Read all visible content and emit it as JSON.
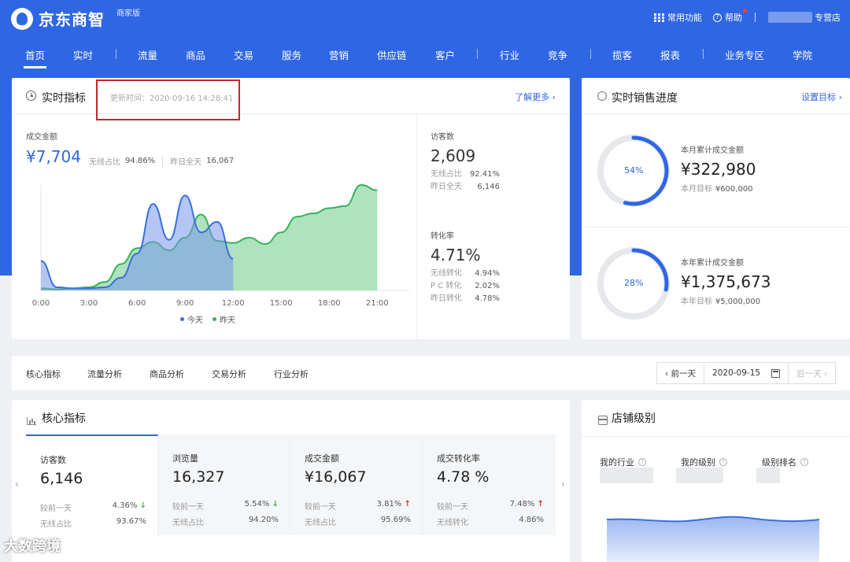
{
  "header": {
    "brand": "京东商智",
    "edition": "商家版",
    "common_functions": "常用功能",
    "help": "帮助",
    "shop_suffix": "专营店"
  },
  "nav": [
    {
      "label": "首页",
      "active": true
    },
    {
      "label": "实时"
    },
    {
      "label": "流量"
    },
    {
      "label": "商品"
    },
    {
      "label": "交易"
    },
    {
      "label": "服务"
    },
    {
      "label": "营销"
    },
    {
      "label": "供应链"
    },
    {
      "label": "客户"
    },
    {
      "label": "行业"
    },
    {
      "label": "竞争"
    },
    {
      "label": "揽客"
    },
    {
      "label": "报表"
    },
    {
      "label": "业务专区"
    },
    {
      "label": "学院"
    }
  ],
  "realtime": {
    "title": "实时指标",
    "update_time": "更新时间：2020-09-16 14:28:41",
    "more": "了解更多 ›",
    "sales_label": "成交金额",
    "sales_value": "¥7,704",
    "wireless_share_label": "无线占比",
    "wireless_share": "94.86%",
    "yesterday_label": "昨日全天",
    "yesterday_value": "16,067",
    "visitors_label": "访客数",
    "visitors_value": "2,609",
    "visitors_wireless_label": "无线占比",
    "visitors_wireless": "92.41%",
    "visitors_yesterday_label": "昨日全天",
    "visitors_yesterday": "6,146",
    "conv_label": "转化率",
    "conv_value": "4.71%",
    "conv_wireless_label": "无线转化",
    "conv_wireless": "4.94%",
    "conv_pc_label": "P C 转化",
    "conv_pc": "2.02%",
    "conv_yesterday_label": "昨日转化",
    "conv_yesterday": "4.78%"
  },
  "chart_data": {
    "type": "area",
    "x": [
      "0:00",
      "1:00",
      "2:00",
      "3:00",
      "4:00",
      "5:00",
      "6:00",
      "7:00",
      "8:00",
      "9:00",
      "10:00",
      "11:00",
      "12:00",
      "13:00",
      "14:00",
      "15:00",
      "16:00",
      "17:00",
      "18:00",
      "19:00",
      "20:00",
      "21:00",
      "22:00",
      "23:00"
    ],
    "tick_labels": [
      "0:00",
      "3:00",
      "6:00",
      "9:00",
      "12:00",
      "15:00",
      "18:00",
      "21:00"
    ],
    "series": [
      {
        "name": "今天",
        "color": "#3a6fe0",
        "values": [
          28,
          3,
          2,
          2,
          3,
          12,
          35,
          82,
          48,
          90,
          55,
          65,
          30
        ]
      },
      {
        "name": "昨天",
        "color": "#34b35a",
        "values": [
          2,
          1,
          2,
          3,
          8,
          25,
          40,
          46,
          38,
          50,
          72,
          47,
          45,
          50,
          44,
          55,
          70,
          73,
          78,
          80,
          100,
          95
        ]
      }
    ],
    "xlabel": "",
    "ylabel": "",
    "grid": false,
    "legend": "bottom-center"
  },
  "progress": {
    "title": "实时销售进度",
    "set_target": "设置目标 ›",
    "month_label": "本月累计成交金额",
    "month_value": "¥322,980",
    "month_target_label": "本月目标",
    "month_target": "¥600,000",
    "month_pct": "54%",
    "month_fraction": 0.54,
    "year_label": "本年累计成交金额",
    "year_value": "¥1,375,673",
    "year_target_label": "本年目标",
    "year_target": "¥5,000,000",
    "year_pct": "28%",
    "year_fraction": 0.28,
    "accent": "#2f66e3"
  },
  "tabs": [
    "核心指标",
    "流量分析",
    "商品分析",
    "交易分析",
    "行业分析"
  ],
  "date_nav": {
    "prev": "‹ 前一天",
    "date": "2020-09-15",
    "next": "后一天 ›"
  },
  "core": {
    "title": "核心指标",
    "metrics": [
      {
        "label": "访客数",
        "value": "6,146",
        "cmp_label": "较前一天",
        "cmp": "4.36%",
        "dir": "down",
        "sub_label": "无线占比",
        "sub": "93.67%"
      },
      {
        "label": "浏览量",
        "value": "16,327",
        "cmp_label": "较前一天",
        "cmp": "5.54%",
        "dir": "down",
        "sub_label": "无线占比",
        "sub": "94.20%"
      },
      {
        "label": "成交金额",
        "value": "¥16,067",
        "cmp_label": "较前一天",
        "cmp": "3.81%",
        "dir": "up",
        "sub_label": "无线占比",
        "sub": "95.69%"
      },
      {
        "label": "成交转化率",
        "value": "4.78 %",
        "cmp_label": "较前一天",
        "cmp": "7.48%",
        "dir": "up",
        "sub_label": "无线转化",
        "sub": "4.86%"
      }
    ],
    "arrows": {
      "up": "↑",
      "down": "↓"
    }
  },
  "level": {
    "title": "店铺级别",
    "my_industry": "我的行业",
    "my_level": "我的级别",
    "level_rank": "级别排名",
    "help_glyph": "?"
  },
  "watermark": "大数跨境"
}
